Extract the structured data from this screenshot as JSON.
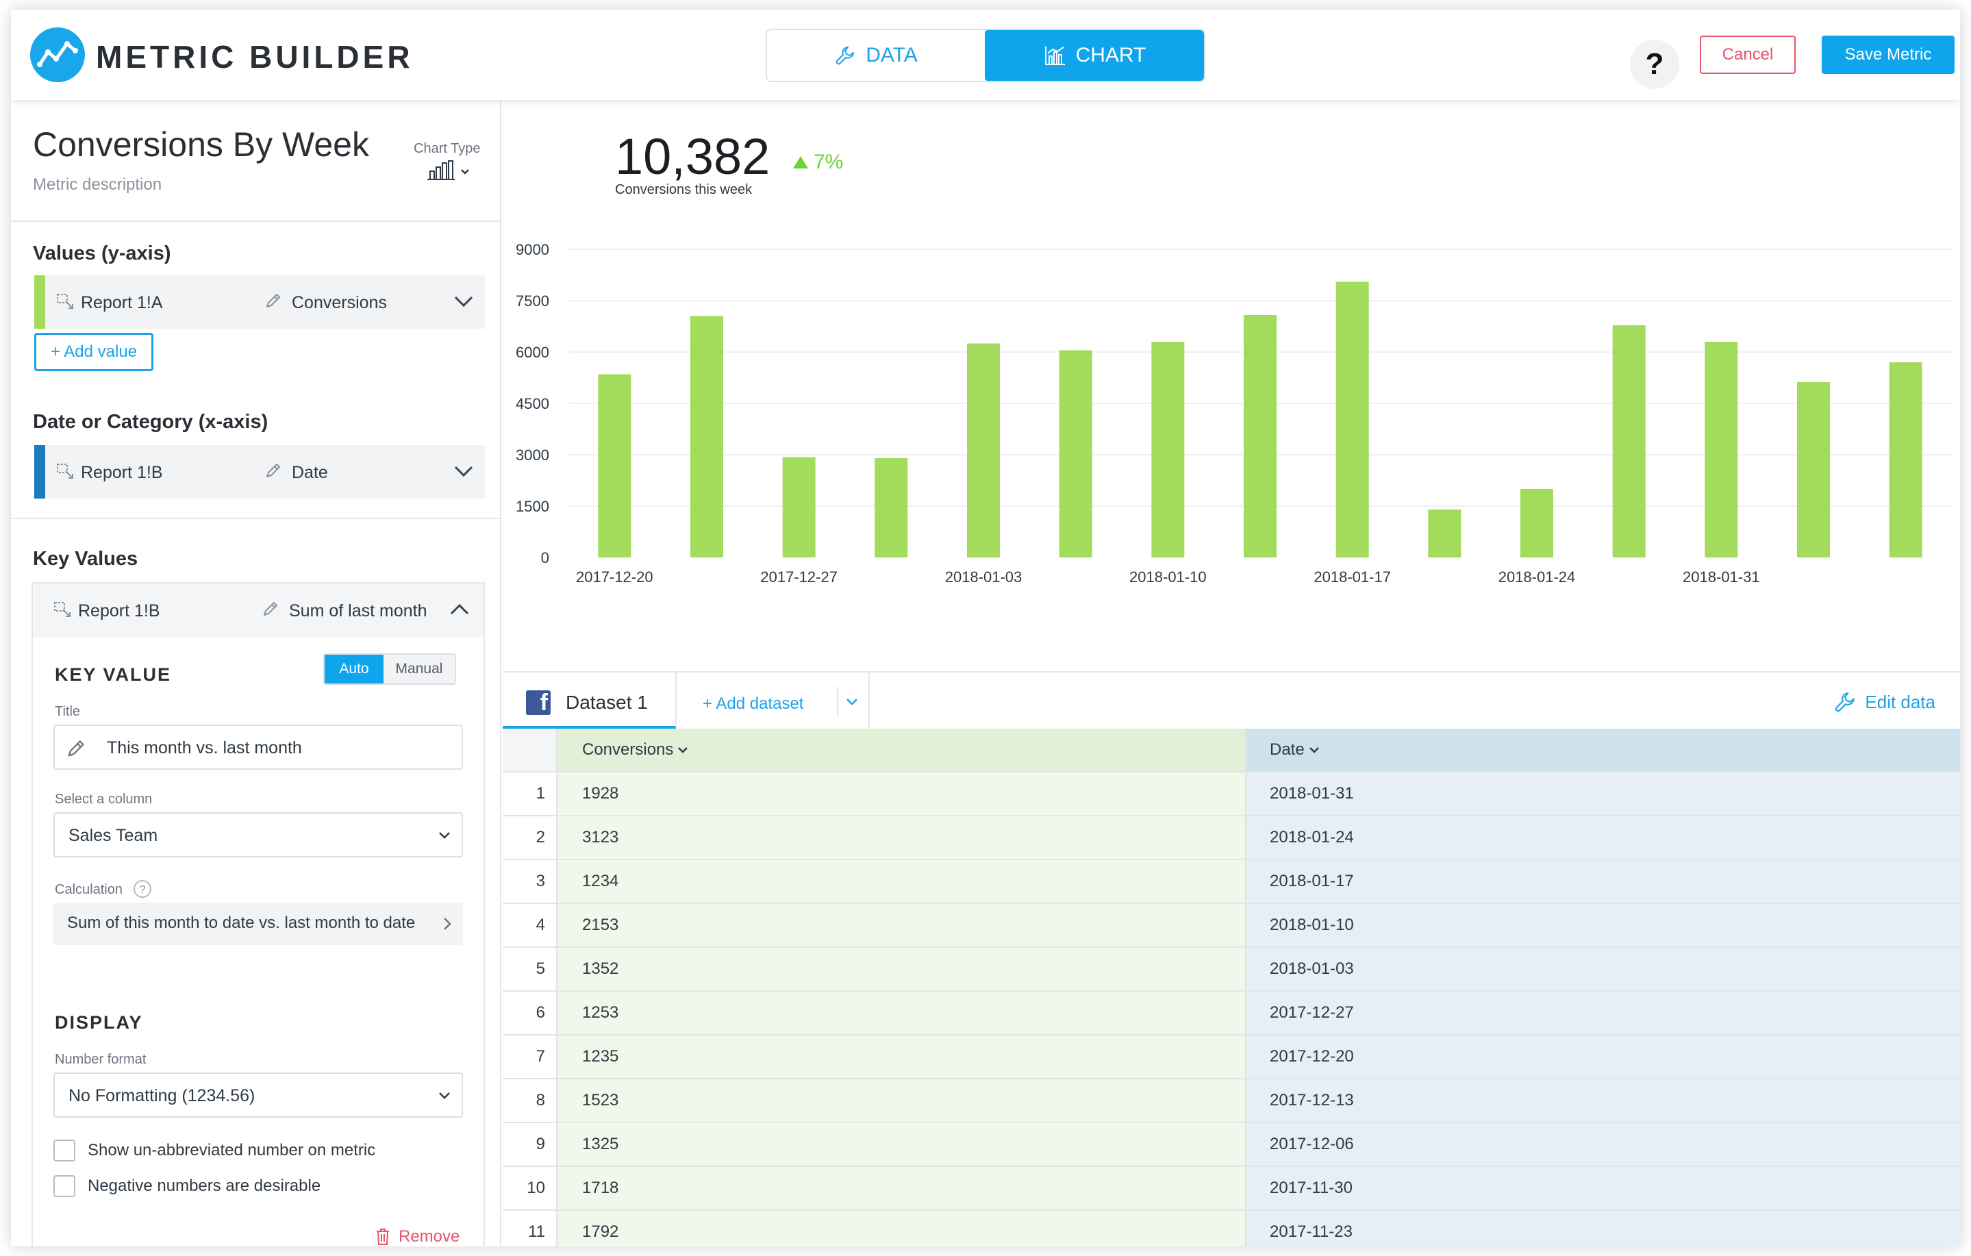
{
  "app": {
    "title": "METRIC BUILDER"
  },
  "mode_toggle": {
    "data_label": "DATA",
    "chart_label": "CHART",
    "active": "CHART"
  },
  "header": {
    "help_label": "?",
    "cancel_label": "Cancel",
    "save_label": "Save Metric"
  },
  "metric": {
    "title": "Conversions By Week",
    "description": "Metric description",
    "chart_type_label": "Chart Type",
    "chart_type_icon": "bar-chart-icon"
  },
  "values_section": {
    "label": "Values (y-axis)",
    "source": "Report 1!A",
    "field": "Conversions",
    "stripe_color": "#a3dc5b",
    "add_label": "+ Add value"
  },
  "category_section": {
    "label": "Date or Category (x-axis)",
    "source": "Report 1!B",
    "field": "Date",
    "stripe_color": "#1c7bbf"
  },
  "key_values": {
    "label": "Key Values",
    "source": "Report 1!B",
    "field": "Sum of last month",
    "heading": "KEY VALUE",
    "mode_auto": "Auto",
    "mode_manual": "Manual",
    "mode_selected": "Auto",
    "title_label": "Title",
    "title_value": "This month vs. last month",
    "column_label": "Select a column",
    "column_value": "Sales Team",
    "calc_label": "Calculation",
    "calc_value": "Sum of this month to date vs. last month to date",
    "display_heading": "DISPLAY",
    "format_label": "Number format",
    "format_value": "No Formatting (1234.56)",
    "check1_label": "Show un-abbreviated number on metric",
    "check1_checked": false,
    "check2_label": "Negative numbers are desirable",
    "check2_checked": false,
    "remove_label": "Remove"
  },
  "summary": {
    "value": "10,382",
    "change": "7%",
    "change_direction": "up",
    "caption": "Conversions this week"
  },
  "chart_data": {
    "type": "bar",
    "bar_color": "#a3dc5b",
    "grid": true,
    "ylim": [
      0,
      9000
    ],
    "yticks": [
      0,
      1500,
      3000,
      4500,
      6000,
      7500,
      9000
    ],
    "xtick_labels": [
      "2017-12-20",
      "2017-12-27",
      "2018-01-03",
      "2018-01-10",
      "2018-01-17",
      "2018-01-24",
      "2018-01-31"
    ],
    "xtick_positions": [
      0,
      2,
      4,
      6,
      8,
      10,
      12
    ],
    "values": [
      5350,
      7050,
      2930,
      2900,
      6250,
      6050,
      6300,
      7080,
      8050,
      1400,
      2000,
      6780,
      6300,
      5120,
      5700
    ]
  },
  "dataset_bar": {
    "tab_label": "Dataset 1",
    "source_icon": "facebook-icon",
    "add_label": "+ Add dataset",
    "edit_label": "Edit data"
  },
  "table": {
    "columns": [
      "Conversions",
      "Date"
    ],
    "rows": [
      {
        "index": "1",
        "c1": "1928",
        "c2": "2018-01-31"
      },
      {
        "index": "2",
        "c1": "3123",
        "c2": "2018-01-24"
      },
      {
        "index": "3",
        "c1": "1234",
        "c2": "2018-01-17"
      },
      {
        "index": "4",
        "c1": "2153",
        "c2": "2018-01-10"
      },
      {
        "index": "5",
        "c1": "1352",
        "c2": "2018-01-03"
      },
      {
        "index": "6",
        "c1": "1253",
        "c2": "2017-12-27"
      },
      {
        "index": "7",
        "c1": "1235",
        "c2": "2017-12-20"
      },
      {
        "index": "8",
        "c1": "1523",
        "c2": "2017-12-13"
      },
      {
        "index": "9",
        "c1": "1325",
        "c2": "2017-12-06"
      },
      {
        "index": "10",
        "c1": "1718",
        "c2": "2017-11-30"
      },
      {
        "index": "11",
        "c1": "1792",
        "c2": "2017-11-23"
      }
    ]
  }
}
